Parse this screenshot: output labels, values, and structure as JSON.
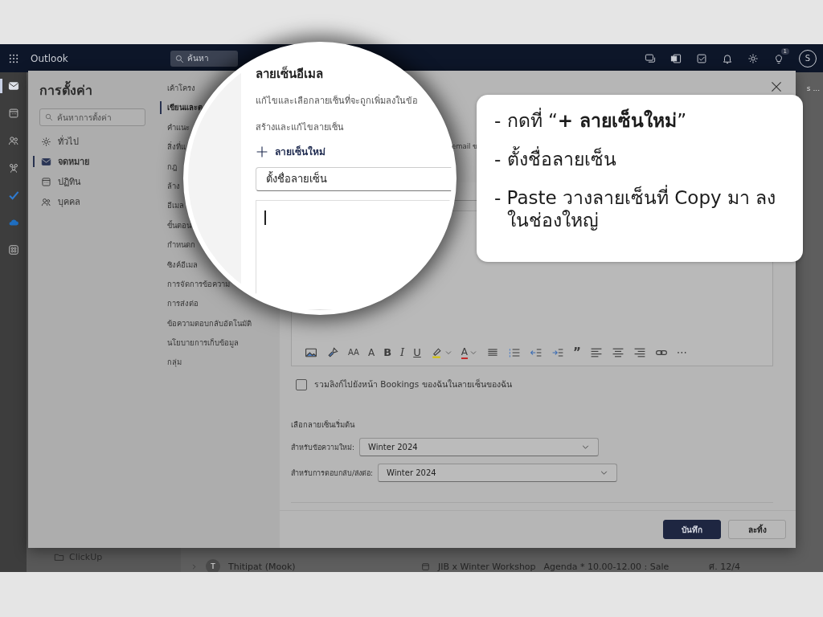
{
  "header": {
    "app_name": "Outlook",
    "search": {
      "placeholder": "ค้นหา"
    },
    "notification_badge": "1",
    "avatar_initial": "S"
  },
  "rail": [
    {
      "kind": "mail",
      "selected": true
    },
    {
      "kind": "calendar",
      "selected": false
    },
    {
      "kind": "people",
      "selected": false
    },
    {
      "kind": "groups",
      "selected": false
    },
    {
      "kind": "todo",
      "selected": false
    },
    {
      "kind": "cloud",
      "selected": false
    },
    {
      "kind": "apps",
      "selected": false
    }
  ],
  "folder_pane": {
    "items": [
      {
        "label": "ClickUp"
      }
    ]
  },
  "message_list": {
    "right_fragment": "s ...",
    "rows": [
      {
        "avatar_initial": "T",
        "sender": "Thitipat (Mook)",
        "subject": "JIB x Winter Workshop",
        "preview": "Agenda * 10.00-12.00 : Sale",
        "date": "ศ. 12/4"
      }
    ]
  },
  "settings": {
    "title": "การตั้งค่า",
    "search": {
      "placeholder": "ค้นหาการตั้งค่า"
    },
    "categories": [
      {
        "kind": "gear",
        "label": "ทั่วไป",
        "selected": false
      },
      {
        "kind": "mail",
        "label": "จดหมาย",
        "selected": true
      },
      {
        "kind": "calendar",
        "label": "ปฏิทิน",
        "selected": false
      },
      {
        "kind": "people",
        "label": "บุคคล",
        "selected": false
      }
    ],
    "sections": [
      {
        "label": "เค้าโครง",
        "selected": false
      },
      {
        "label": "เขียนและต",
        "selected": true
      },
      {
        "label": "คำแนะ",
        "selected": false
      },
      {
        "label": "สิ่งที่แ",
        "selected": false
      },
      {
        "label": "กฎ",
        "selected": false
      },
      {
        "label": "ล้าง",
        "selected": false
      },
      {
        "label": "อีเมล",
        "selected": false
      },
      {
        "label": "ขั้นตอน",
        "selected": false
      },
      {
        "label": "กำหนดก",
        "selected": false
      },
      {
        "label": "ซิงค์อีเมล",
        "selected": false
      },
      {
        "label": "การจัดการข้อความ",
        "selected": false
      },
      {
        "label": "การส่งต่อ",
        "selected": false
      },
      {
        "label": "ข้อความตอบกลับอัตโนมัติ",
        "selected": false
      },
      {
        "label": "นโยบายการเก็บข้อมูล",
        "selected": false
      },
      {
        "label": "กลุ่ม",
        "selected": false
      }
    ],
    "signature": {
      "description_fragment": "email ข",
      "toolbar": [
        {
          "kind": "image"
        },
        {
          "kind": "brush"
        },
        {
          "kind": "fontsize",
          "text": "AA"
        },
        {
          "kind": "grow",
          "text": "A"
        },
        {
          "kind": "bold",
          "text": "B"
        },
        {
          "kind": "italic",
          "text": "I"
        },
        {
          "kind": "underline",
          "text": "U"
        },
        {
          "kind": "highlight"
        },
        {
          "kind": "fontcolor",
          "text": "A"
        },
        {
          "kind": "bullets"
        },
        {
          "kind": "numbering"
        },
        {
          "kind": "outdent"
        },
        {
          "kind": "indent"
        },
        {
          "kind": "quote",
          "text": "”"
        },
        {
          "kind": "alignleft"
        },
        {
          "kind": "aligncenter"
        },
        {
          "kind": "alignright"
        },
        {
          "kind": "link"
        },
        {
          "kind": "more",
          "text": "⋯"
        }
      ],
      "bookings_checkbox": {
        "label": "รวมลิงก์ไปยังหน้า Bookings ของฉันในลายเซ็นของฉัน",
        "checked": false
      },
      "defaults_heading": "เลือกลายเซ็นเริ่มต้น",
      "defaults": [
        {
          "label": "สำหรับข้อความใหม่:",
          "value": "Winter 2024"
        },
        {
          "label": "สำหรับการตอบกลับ/ส่งต่อ:",
          "value": "Winter 2024"
        }
      ]
    },
    "buttons": [
      {
        "kind": "primary",
        "label": "บันทึก"
      },
      {
        "kind": "secondary",
        "label": "ละทิ้ง"
      }
    ]
  },
  "magnifier": {
    "title": "ลายเซ็นอีเมล",
    "description": "แก้ไขและเลือกลายเซ็นที่จะถูกเพิ่มลงในข้อ",
    "subheading": "สร้างและแก้ไขลายเซ็น",
    "new_signature_button": "ลายเซ็นใหม่",
    "name_field": {
      "value": "ตั้งชื่อลายเซ็น"
    }
  },
  "callout": {
    "steps": [
      "- กดที่ “**+ ลายเซ็นใหม่**”",
      "- ตั้งชื่อลายเซ็น",
      "- Paste วางลายเซ็นที่ Copy มา ลงในช่องใหญ่"
    ]
  }
}
